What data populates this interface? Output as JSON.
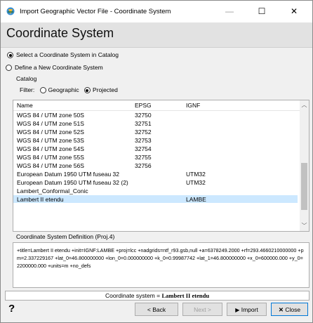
{
  "window": {
    "title": "Import Geographic Vector File - Coordinate System",
    "controls": {
      "minimize": "—",
      "maximize": "☐",
      "close": "✕"
    }
  },
  "header": {
    "title": "Coordinate System"
  },
  "mode_options": [
    {
      "label": "Select a Coordinate System in Catalog",
      "selected": true
    },
    {
      "label": "Define a New Coordinate System",
      "selected": false
    }
  ],
  "catalog": {
    "group_label": "Catalog",
    "filter_label": "Filter:",
    "filter_options": [
      {
        "label": "Geographic",
        "selected": false
      },
      {
        "label": "Projected",
        "selected": true
      }
    ],
    "columns": [
      "Name",
      "EPSG",
      "IGNF"
    ],
    "rows": [
      {
        "name": "WGS 84 / UTM zone 50S",
        "epsg": "32750",
        "ignf": ""
      },
      {
        "name": "WGS 84 / UTM zone 51S",
        "epsg": "32751",
        "ignf": ""
      },
      {
        "name": "WGS 84 / UTM zone 52S",
        "epsg": "32752",
        "ignf": ""
      },
      {
        "name": "WGS 84 / UTM zone 53S",
        "epsg": "32753",
        "ignf": ""
      },
      {
        "name": "WGS 84 / UTM zone 54S",
        "epsg": "32754",
        "ignf": ""
      },
      {
        "name": "WGS 84 / UTM zone 55S",
        "epsg": "32755",
        "ignf": ""
      },
      {
        "name": "WGS 84 / UTM zone 56S",
        "epsg": "32756",
        "ignf": ""
      },
      {
        "name": "European Datum 1950 UTM fuseau 32",
        "epsg": "",
        "ignf": "UTM32"
      },
      {
        "name": "European Datum 1950 UTM fuseau 32 (2)",
        "epsg": "",
        "ignf": "UTM32"
      },
      {
        "name": "Lambert_Conformal_Conic",
        "epsg": "",
        "ignf": ""
      },
      {
        "name": "Lambert II etendu",
        "epsg": "",
        "ignf": "LAMBE",
        "selected": true
      }
    ]
  },
  "definition": {
    "label": "Coordinate System Definition (Proj.4)",
    "text": "+title=Lambert II etendu +init=IGNF:LAMBE +proj=lcc +nadgrids=ntf_r93.gsb,null +a=6378249.2000 +rf=293.4660210000000 +pm=2.337229167 +lat_0=46.800000000 +lon_0=0.000000000 +k_0=0.99987742 +lat_1=46.800000000 +x_0=600000.000 +y_0=2200000.000 +units=m +no_defs"
  },
  "status": {
    "prefix": "Coordinate system = ",
    "value": "Lambert II etendu"
  },
  "footer": {
    "help": "?",
    "back": "< Back",
    "next": "Next >",
    "import": "Import",
    "close": "Close"
  },
  "colors": {
    "selection": "#cce8ff",
    "focus_border": "#0078d7"
  },
  "icons": [
    "app-icon",
    "help-icon",
    "play-icon",
    "close-x-icon"
  ]
}
